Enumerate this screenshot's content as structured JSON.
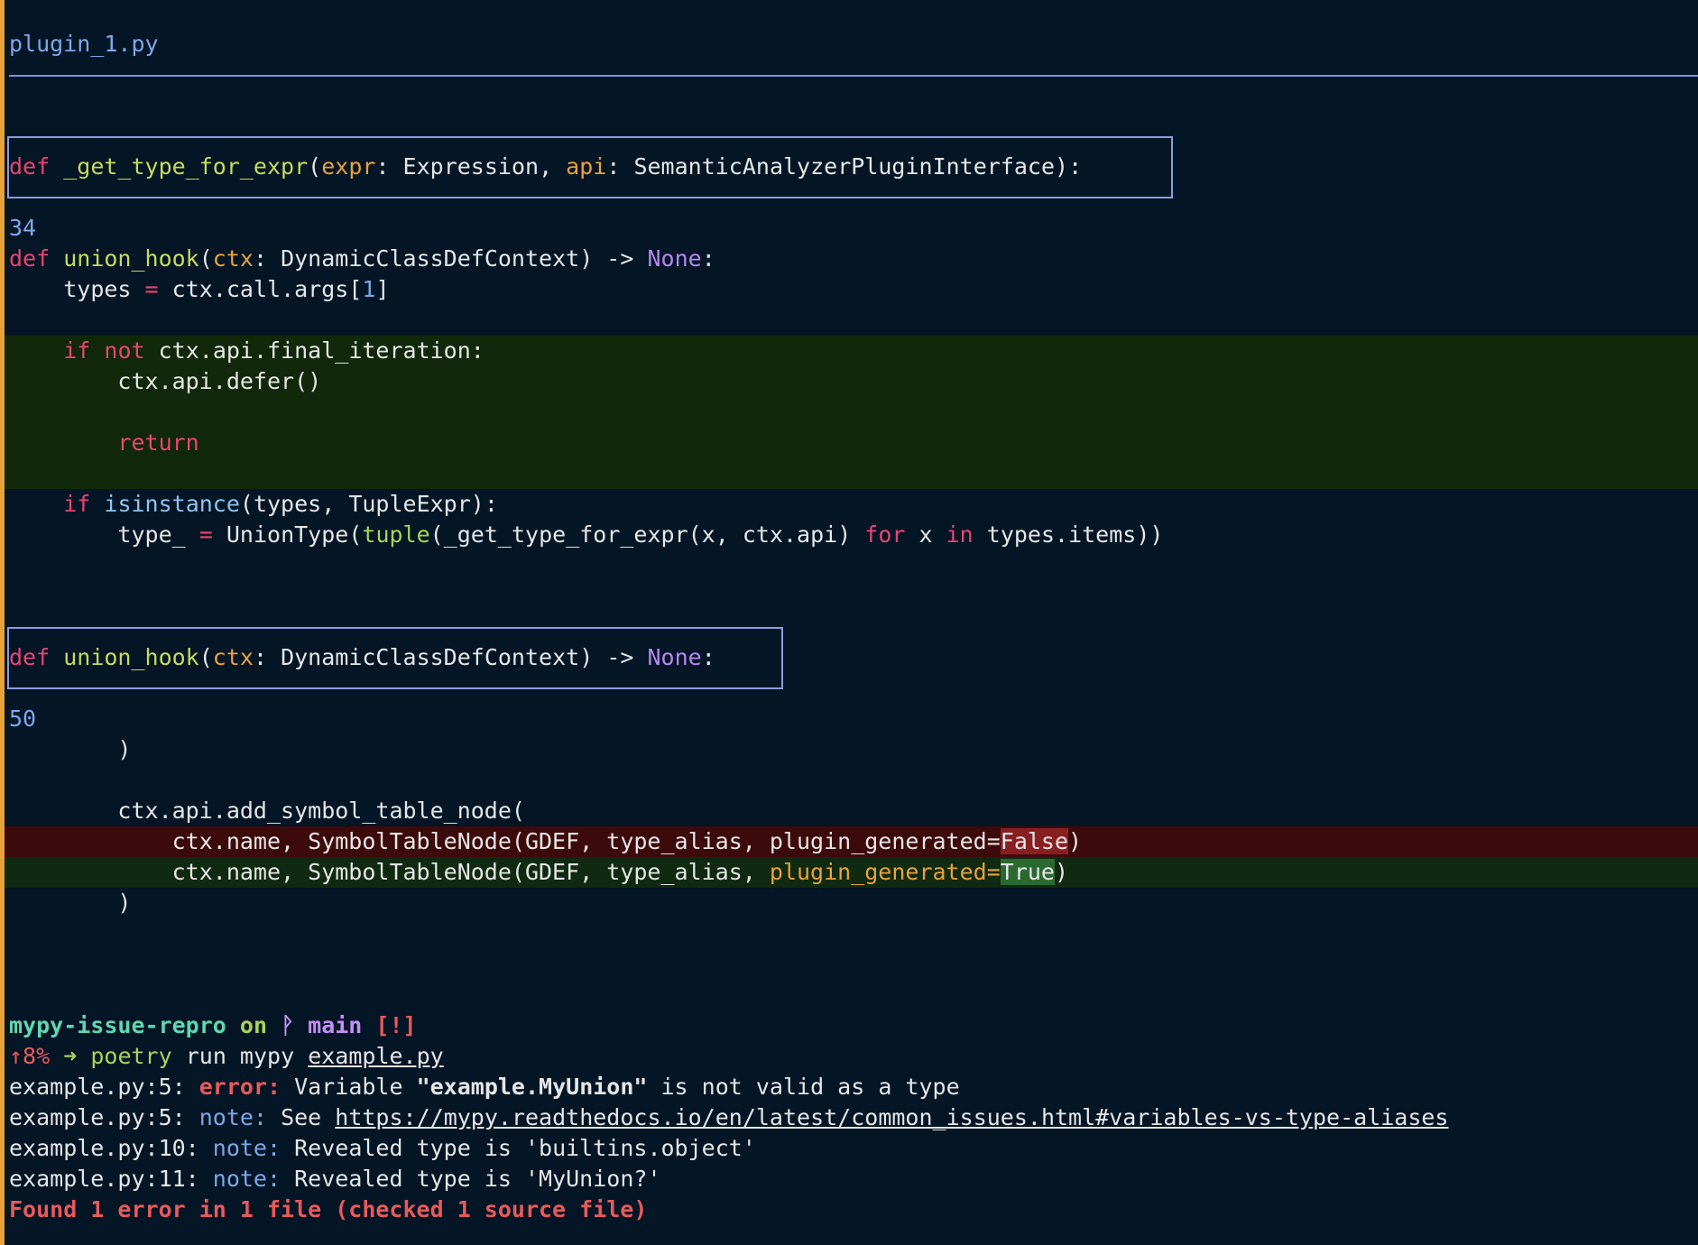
{
  "diff": {
    "filename": "plugin_1.py",
    "hunk1_header": {
      "kw": "def",
      "fn": "_get_type_for_expr",
      "p1": "expr",
      "t1": "Expression",
      "p2": "api",
      "t2": "SemanticAnalyzerPluginInterface"
    },
    "hunk1_lineno": "34",
    "hunk2_header": {
      "kw": "def",
      "fn": "union_hook",
      "p1": "ctx",
      "t1": "DynamicClassDefContext",
      "arrow": "->",
      "ret": "None"
    },
    "hunk2_lineno": "50",
    "code": {
      "l_def_kw": "def",
      "l_def_fn": "union_hook",
      "l_def_par": "ctx",
      "l_def_type": "DynamicClassDefContext",
      "l_def_ret": "None",
      "types_var": "types",
      "types_rhs": "ctx.call.args[",
      "types_idx": "1",
      "if1": "if",
      "not1": "not",
      "if1_cond": "ctx.api.final_iteration:",
      "defer": "ctx.api.defer()",
      "ret": "return",
      "if2": "if",
      "isinst": "isinstance",
      "if2_rest": "(types, TupleExpr):",
      "type_var": "type_",
      "union_call": "UnionType(",
      "tuple_fn": "tuple",
      "gen_a": "(_get_type_for_expr(x, ctx.api) ",
      "for_kw": "for",
      "gen_x": " x ",
      "in_kw": "in",
      "gen_b": " types.items))",
      "close_paren": ")",
      "add_sym": "ctx.api.add_symbol_table_node(",
      "del_line_pre": "ctx.name, SymbolTableNode(GDEF, type_alias, plugin_generated=",
      "del_val": "False",
      "add_line_pre": "ctx.name, SymbolTableNode(GDEF, type_alias, ",
      "add_kw": "plugin_generated=",
      "add_val": "True",
      "end_paren": ")"
    }
  },
  "terminal": {
    "dir": "mypy-issue-repro",
    "on": "on",
    "branch_icon": "branch-icon",
    "branch": "main",
    "status": "[!]",
    "pct": "↑8%",
    "arrow": "➜",
    "cmd": "poetry",
    "args": "run mypy",
    "file": "example.py",
    "out": [
      {
        "loc": "example.py:5:",
        "kind": "error:",
        "text_a": "Variable ",
        "bold": "\"example.MyUnion\"",
        "text_b": " is not valid as a type"
      },
      {
        "loc": "example.py:5:",
        "kind": "note:",
        "text_a": "See ",
        "link": "https://mypy.readthedocs.io/en/latest/common_issues.html#variables-vs-type-aliases"
      },
      {
        "loc": "example.py:10:",
        "kind": "note:",
        "text_a": "Revealed type is 'builtins.object'"
      },
      {
        "loc": "example.py:11:",
        "kind": "note:",
        "text_a": "Revealed type is 'MyUnion?'"
      }
    ],
    "summary": "Found 1 error in 1 file (checked 1 source file)"
  }
}
